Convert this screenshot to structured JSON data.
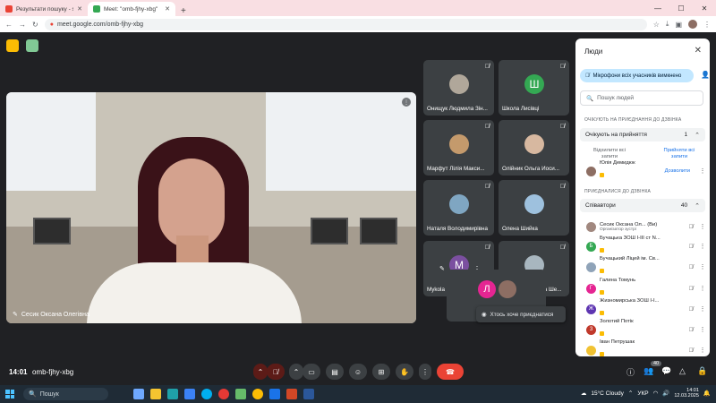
{
  "browser": {
    "tabs": [
      {
        "title": "Результати пошуку - s.sesyk@",
        "favicon_color": "#ea4335",
        "active": false
      },
      {
        "title": "Meet: \"omb-fjhy-xbg\"",
        "favicon_color": "#34a853",
        "active": true
      }
    ],
    "url": "meet.google.com/omb-fjhy-xbg"
  },
  "meet": {
    "main_speaker": "Сесик Оксана Олегівна",
    "tiles": [
      {
        "name": "Онищук Людмила Зін...",
        "initial": "",
        "color": "#b0a79a"
      },
      {
        "name": "Школа Лисівці",
        "initial": "Ш",
        "color": "#34a853"
      },
      {
        "name": "Марфут Лілія Макси...",
        "initial": "",
        "color": "#c49a6c"
      },
      {
        "name": "Олійник Ольга Йоси...",
        "initial": "",
        "color": "#d7b8a0"
      },
      {
        "name": "Наталя Володимирівна",
        "initial": "",
        "color": "#7fa6c2"
      },
      {
        "name": "Олена Шийка",
        "initial": "",
        "color": "#9ec1de"
      },
      {
        "name": "Mykola Cherny",
        "initial": "M",
        "color": "#7b4fa0"
      },
      {
        "name": "Леся Михайлівна Ше...",
        "initial": "",
        "color": "#a8b6bf"
      }
    ],
    "bottom_tile_initial": "Л",
    "toast": "Хтось хоче приєднатися",
    "time": "14:01",
    "code": "omb-fjhy-xbg",
    "participants_badge": "40"
  },
  "people_panel": {
    "title": "Люди",
    "mute_all": "Мікрофони всіх учасників вимкнено",
    "search_placeholder": "Пошук людей",
    "waiting_section": "ОЧІКУЮТЬ НА ПРИЄДНАННЯ ДО ДЗВІНКА",
    "waiting_group": "Очікують на прийняття",
    "waiting_count": "1",
    "deny_all": "Відхилити всі запити",
    "admit_all": "Прийняти всі запити",
    "waiting_person": "Юлія Демидюк",
    "admit": "Дозволити",
    "joined_section": "ПРИЄДНАЛИСЯ ДО ДЗВІНКА",
    "joined_group": "Співавтори",
    "joined_count": "40",
    "people": [
      {
        "name": "Сесик Оксана Ол... (Ви)",
        "sub": "Організатор зустрі",
        "initial": "",
        "color": "#a1887f"
      },
      {
        "name": "Бучацька ЗОШ І-ІІІ ст N...",
        "sub": "",
        "initial": "Б",
        "color": "#34a853"
      },
      {
        "name": "Бучацький Ліцей ім. Св...",
        "sub": "",
        "initial": "",
        "color": "#8fa3b8"
      },
      {
        "name": "Галина Томунь",
        "sub": "",
        "initial": "Г",
        "color": "#e52592"
      },
      {
        "name": "Жизномирська ЗОШ І-І...",
        "sub": "",
        "initial": "Ж",
        "color": "#5e35b1"
      },
      {
        "name": "Золотий Потік",
        "sub": "",
        "initial": "З",
        "color": "#c0392b"
      },
      {
        "name": "Іван Петрушак",
        "sub": "",
        "initial": "",
        "color": "#f1c232"
      }
    ]
  },
  "taskbar": {
    "search": "Пошук",
    "weather": "15°C  Cloudy",
    "lang": "УКР",
    "time": "14:01",
    "date": "12.03.2025"
  }
}
